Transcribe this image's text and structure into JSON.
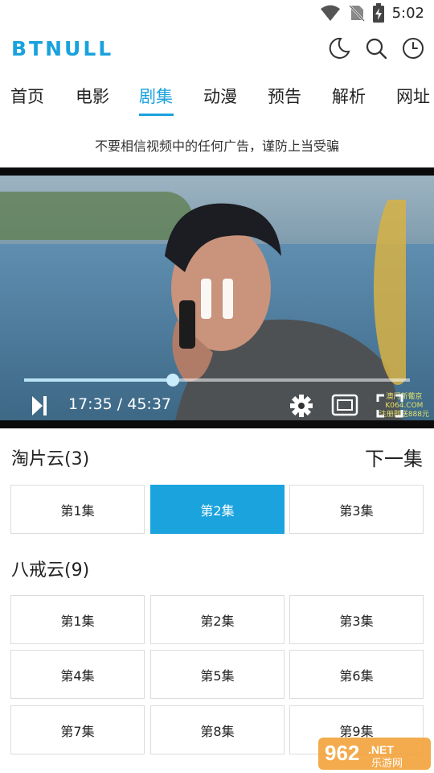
{
  "status_bar": {
    "time": "5:02"
  },
  "header": {
    "brand": "BTNULL"
  },
  "tabs": [
    {
      "label": "首页"
    },
    {
      "label": "电影"
    },
    {
      "label": "剧集"
    },
    {
      "label": "动漫"
    },
    {
      "label": "预告"
    },
    {
      "label": "解析"
    },
    {
      "label": "网址"
    }
  ],
  "notice": "不要相信视频中的任何广告，谨防上当受骗",
  "player": {
    "time_display": "17:35 / 45:37",
    "progress_fraction": 0.385,
    "watermark": [
      "澳门新葡京",
      "K064.COM",
      "注册即送888元"
    ]
  },
  "source_groups": [
    {
      "title": "淘片云(3)",
      "episodes": [
        "第1集",
        "第2集",
        "第3集"
      ]
    },
    {
      "title": "八戒云(9)",
      "episodes": [
        "第1集",
        "第2集",
        "第3集",
        "第4集",
        "第5集",
        "第6集",
        "第7集",
        "第8集",
        "第9集"
      ]
    }
  ],
  "next_episode_label": "下一集",
  "site_badge": {
    "number": "962",
    "suffix": ".NET",
    "sub": "乐游网"
  },
  "colors": {
    "accent": "#19a2dc",
    "selected_bg": "#1aa3dd"
  }
}
